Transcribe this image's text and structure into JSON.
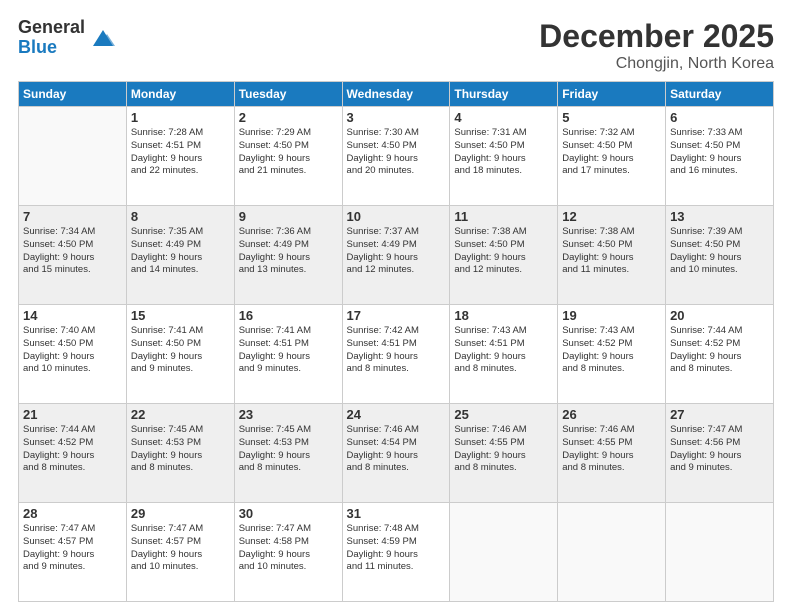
{
  "header": {
    "logo_general": "General",
    "logo_blue": "Blue",
    "month": "December 2025",
    "location": "Chongjin, North Korea"
  },
  "days_of_week": [
    "Sunday",
    "Monday",
    "Tuesday",
    "Wednesday",
    "Thursday",
    "Friday",
    "Saturday"
  ],
  "weeks": [
    [
      {
        "day": "",
        "info": ""
      },
      {
        "day": "1",
        "info": "Sunrise: 7:28 AM\nSunset: 4:51 PM\nDaylight: 9 hours\nand 22 minutes."
      },
      {
        "day": "2",
        "info": "Sunrise: 7:29 AM\nSunset: 4:50 PM\nDaylight: 9 hours\nand 21 minutes."
      },
      {
        "day": "3",
        "info": "Sunrise: 7:30 AM\nSunset: 4:50 PM\nDaylight: 9 hours\nand 20 minutes."
      },
      {
        "day": "4",
        "info": "Sunrise: 7:31 AM\nSunset: 4:50 PM\nDaylight: 9 hours\nand 18 minutes."
      },
      {
        "day": "5",
        "info": "Sunrise: 7:32 AM\nSunset: 4:50 PM\nDaylight: 9 hours\nand 17 minutes."
      },
      {
        "day": "6",
        "info": "Sunrise: 7:33 AM\nSunset: 4:50 PM\nDaylight: 9 hours\nand 16 minutes."
      }
    ],
    [
      {
        "day": "7",
        "info": "Sunrise: 7:34 AM\nSunset: 4:50 PM\nDaylight: 9 hours\nand 15 minutes."
      },
      {
        "day": "8",
        "info": "Sunrise: 7:35 AM\nSunset: 4:49 PM\nDaylight: 9 hours\nand 14 minutes."
      },
      {
        "day": "9",
        "info": "Sunrise: 7:36 AM\nSunset: 4:49 PM\nDaylight: 9 hours\nand 13 minutes."
      },
      {
        "day": "10",
        "info": "Sunrise: 7:37 AM\nSunset: 4:49 PM\nDaylight: 9 hours\nand 12 minutes."
      },
      {
        "day": "11",
        "info": "Sunrise: 7:38 AM\nSunset: 4:50 PM\nDaylight: 9 hours\nand 12 minutes."
      },
      {
        "day": "12",
        "info": "Sunrise: 7:38 AM\nSunset: 4:50 PM\nDaylight: 9 hours\nand 11 minutes."
      },
      {
        "day": "13",
        "info": "Sunrise: 7:39 AM\nSunset: 4:50 PM\nDaylight: 9 hours\nand 10 minutes."
      }
    ],
    [
      {
        "day": "14",
        "info": "Sunrise: 7:40 AM\nSunset: 4:50 PM\nDaylight: 9 hours\nand 10 minutes."
      },
      {
        "day": "15",
        "info": "Sunrise: 7:41 AM\nSunset: 4:50 PM\nDaylight: 9 hours\nand 9 minutes."
      },
      {
        "day": "16",
        "info": "Sunrise: 7:41 AM\nSunset: 4:51 PM\nDaylight: 9 hours\nand 9 minutes."
      },
      {
        "day": "17",
        "info": "Sunrise: 7:42 AM\nSunset: 4:51 PM\nDaylight: 9 hours\nand 8 minutes."
      },
      {
        "day": "18",
        "info": "Sunrise: 7:43 AM\nSunset: 4:51 PM\nDaylight: 9 hours\nand 8 minutes."
      },
      {
        "day": "19",
        "info": "Sunrise: 7:43 AM\nSunset: 4:52 PM\nDaylight: 9 hours\nand 8 minutes."
      },
      {
        "day": "20",
        "info": "Sunrise: 7:44 AM\nSunset: 4:52 PM\nDaylight: 9 hours\nand 8 minutes."
      }
    ],
    [
      {
        "day": "21",
        "info": "Sunrise: 7:44 AM\nSunset: 4:52 PM\nDaylight: 9 hours\nand 8 minutes."
      },
      {
        "day": "22",
        "info": "Sunrise: 7:45 AM\nSunset: 4:53 PM\nDaylight: 9 hours\nand 8 minutes."
      },
      {
        "day": "23",
        "info": "Sunrise: 7:45 AM\nSunset: 4:53 PM\nDaylight: 9 hours\nand 8 minutes."
      },
      {
        "day": "24",
        "info": "Sunrise: 7:46 AM\nSunset: 4:54 PM\nDaylight: 9 hours\nand 8 minutes."
      },
      {
        "day": "25",
        "info": "Sunrise: 7:46 AM\nSunset: 4:55 PM\nDaylight: 9 hours\nand 8 minutes."
      },
      {
        "day": "26",
        "info": "Sunrise: 7:46 AM\nSunset: 4:55 PM\nDaylight: 9 hours\nand 8 minutes."
      },
      {
        "day": "27",
        "info": "Sunrise: 7:47 AM\nSunset: 4:56 PM\nDaylight: 9 hours\nand 9 minutes."
      }
    ],
    [
      {
        "day": "28",
        "info": "Sunrise: 7:47 AM\nSunset: 4:57 PM\nDaylight: 9 hours\nand 9 minutes."
      },
      {
        "day": "29",
        "info": "Sunrise: 7:47 AM\nSunset: 4:57 PM\nDaylight: 9 hours\nand 10 minutes."
      },
      {
        "day": "30",
        "info": "Sunrise: 7:47 AM\nSunset: 4:58 PM\nDaylight: 9 hours\nand 10 minutes."
      },
      {
        "day": "31",
        "info": "Sunrise: 7:48 AM\nSunset: 4:59 PM\nDaylight: 9 hours\nand 11 minutes."
      },
      {
        "day": "",
        "info": ""
      },
      {
        "day": "",
        "info": ""
      },
      {
        "day": "",
        "info": ""
      }
    ]
  ]
}
